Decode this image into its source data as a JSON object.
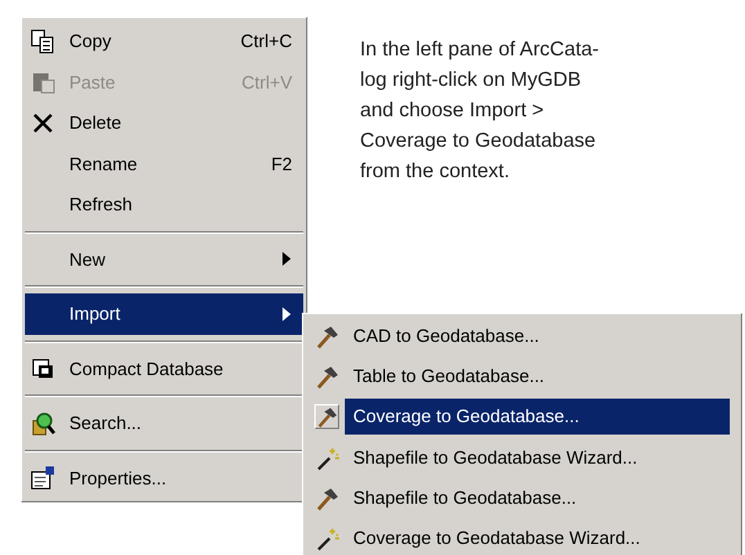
{
  "context_menu": {
    "items": [
      {
        "kind": "item",
        "label": "Copy",
        "shortcut": "Ctrl+C",
        "disabled": false,
        "selected": false
      },
      {
        "kind": "item",
        "label": "Paste",
        "shortcut": "Ctrl+V",
        "disabled": true,
        "selected": false
      },
      {
        "kind": "item",
        "label": "Delete",
        "disabled": false,
        "selected": false
      },
      {
        "kind": "item",
        "label": "Rename",
        "shortcut": "F2",
        "disabled": false,
        "selected": false
      },
      {
        "kind": "item",
        "label": "Refresh",
        "disabled": false,
        "selected": false
      },
      {
        "kind": "separator"
      },
      {
        "kind": "submenu",
        "label": "New",
        "disabled": false,
        "selected": false
      },
      {
        "kind": "separator"
      },
      {
        "kind": "submenu",
        "label": "Import",
        "disabled": false,
        "selected": true
      },
      {
        "kind": "separator"
      },
      {
        "kind": "item",
        "label": "Compact Database",
        "disabled": false,
        "selected": false
      },
      {
        "kind": "separator"
      },
      {
        "kind": "item",
        "label": "Search...",
        "disabled": false,
        "selected": false
      },
      {
        "kind": "separator"
      },
      {
        "kind": "item",
        "label": "Properties...",
        "disabled": false,
        "selected": false
      }
    ]
  },
  "import_submenu": {
    "items": [
      {
        "kind": "tool",
        "label": "CAD to Geodatabase...",
        "selected": false
      },
      {
        "kind": "tool",
        "label": "Table to Geodatabase...",
        "selected": false
      },
      {
        "kind": "tool",
        "label": "Coverage to Geodatabase...",
        "selected": true
      },
      {
        "kind": "wizard",
        "label": "Shapefile to Geodatabase Wizard...",
        "selected": false
      },
      {
        "kind": "tool",
        "label": "Shapefile to Geodatabase...",
        "selected": false
      },
      {
        "kind": "wizard",
        "label": "Coverage to Geodatabase Wizard...",
        "selected": false
      }
    ]
  },
  "instructions": {
    "lines": [
      "In the left pane of ArcCata-",
      "log right-click on MyGDB",
      "and choose Import >",
      "Coverage to Geodatabase",
      "from the context."
    ]
  }
}
